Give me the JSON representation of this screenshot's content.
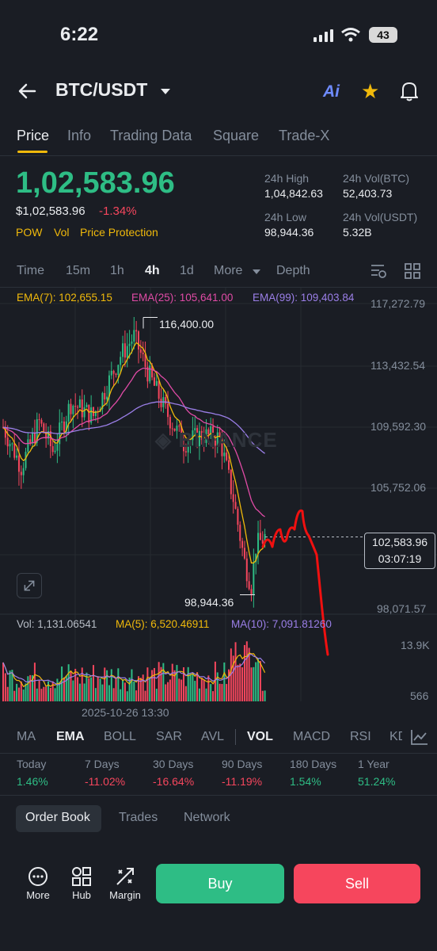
{
  "status": {
    "time": "6:22",
    "battery": "43"
  },
  "header": {
    "title": "BTC/USDT",
    "ai_label": "Ai"
  },
  "tabs": [
    "Price",
    "Info",
    "Trading Data",
    "Square",
    "Trade-X"
  ],
  "price": {
    "last": "1,02,583.96",
    "fiat": "$1,02,583.96",
    "change": "-1.34%",
    "tags": [
      "POW",
      "Vol",
      "Price Protection"
    ]
  },
  "stats": {
    "high_label": "24h High",
    "high": "1,04,842.63",
    "vol_btc_label": "24h Vol(BTC)",
    "vol_btc": "52,403.73",
    "low_label": "24h Low",
    "low": "98,944.36",
    "vol_usdt_label": "24h Vol(USDT)",
    "vol_usdt": "5.32B"
  },
  "intervals": [
    "Time",
    "15m",
    "1h",
    "4h",
    "1d",
    "More",
    "Depth"
  ],
  "active_interval": "4h",
  "ema_legend": {
    "ema7": "EMA(7): 102,655.15",
    "ema25": "EMA(25): 105,641.00",
    "ema99": "EMA(99): 109,403.84"
  },
  "y_ticks": [
    "117,272.79",
    "113,432.54",
    "109,592.30",
    "105,752.06",
    "98,071.57"
  ],
  "current_price": {
    "price": "102,583.96",
    "countdown": "03:07:19"
  },
  "annotations": {
    "high": "116,400.00",
    "low": "98,944.36"
  },
  "watermark": "BINANCE",
  "volume": {
    "vol": "Vol: 1,131.06541",
    "ma5": "MA(5): 6,520.46911",
    "ma10": "MA(10): 7,091.81260",
    "top_tick": "13.9K",
    "bottom_tick": "566"
  },
  "date_label": "2025-10-26 13:30",
  "indicators": [
    "MA",
    "EMA",
    "BOLL",
    "SAR",
    "AVL",
    "VOL",
    "MACD",
    "RSI",
    "KD"
  ],
  "performance": [
    {
      "label": "Today",
      "value": "1.46%"
    },
    {
      "label": "7 Days",
      "value": "-11.02%"
    },
    {
      "label": "30 Days",
      "value": "-16.64%"
    },
    {
      "label": "90 Days",
      "value": "-11.19%"
    },
    {
      "label": "180 Days",
      "value": "1.54%"
    },
    {
      "label": "1 Year",
      "value": "51.24%"
    }
  ],
  "book_tabs": [
    "Order Book",
    "Trades",
    "Network"
  ],
  "bottom_nav": {
    "more": "More",
    "hub": "Hub",
    "margin": "Margin",
    "buy": "Buy",
    "sell": "Sell"
  },
  "colors": {
    "up": "#2ebd85",
    "down": "#f6465d",
    "accent": "#f0b90b",
    "ema7": "#f0b90b",
    "ema25": "#e04ba6",
    "ema99": "#9b7fe8"
  },
  "chart_data": {
    "type": "candlestick",
    "interval": "4h",
    "high_marker": 116400.0,
    "low_marker": 98944.36,
    "y_range": [
      98071.57,
      117272.79
    ],
    "last": 102583.96,
    "ema7": 102655.15,
    "ema25": 105641.0,
    "ema99": 109403.84
  }
}
